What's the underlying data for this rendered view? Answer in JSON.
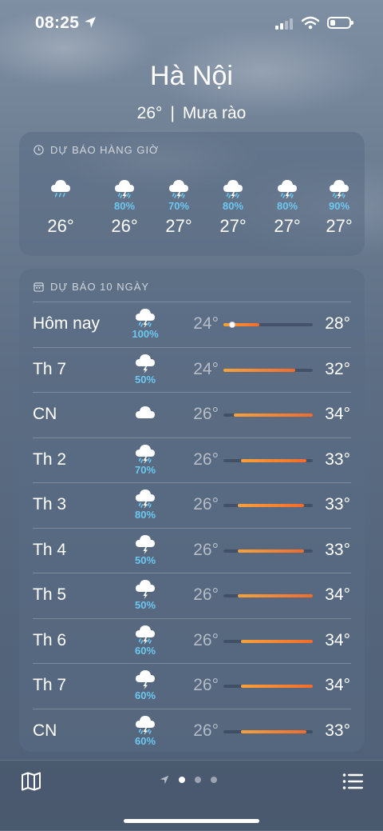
{
  "status_bar": {
    "time": "08:25",
    "icons": [
      "location-arrow-icon",
      "signal-icon",
      "wifi-icon",
      "battery-icon"
    ]
  },
  "location": {
    "city": "Hà Nội",
    "current_temp": "26°",
    "separator": "|",
    "condition": "Mưa rào"
  },
  "hourly": {
    "header": "DỰ BÁO HÀNG GIỜ",
    "items": [
      {
        "icon": "rain-cloud-icon",
        "precip": "",
        "temp": "26°"
      },
      {
        "icon": "thunderstorm-rain-icon",
        "precip": "80%",
        "temp": "26°"
      },
      {
        "icon": "thunderstorm-rain-icon",
        "precip": "70%",
        "temp": "27°"
      },
      {
        "icon": "thunderstorm-rain-icon",
        "precip": "80%",
        "temp": "27°"
      },
      {
        "icon": "thunderstorm-rain-icon",
        "precip": "80%",
        "temp": "27°"
      },
      {
        "icon": "thunderstorm-rain-icon",
        "precip": "90%",
        "temp": "27°"
      }
    ]
  },
  "daily": {
    "header": "DỰ BÁO 10 NGÀY",
    "range_scale": {
      "min": 24,
      "max": 34
    },
    "items": [
      {
        "day": "Hôm nay",
        "icon": "thunderstorm-rain-icon",
        "precip": "100%",
        "low": "24°",
        "high": "28°",
        "low_val": 24,
        "high_val": 28,
        "current_val": 25
      },
      {
        "day": "Th 7",
        "icon": "thunderstorm-icon",
        "precip": "50%",
        "low": "24°",
        "high": "32°",
        "low_val": 24,
        "high_val": 32
      },
      {
        "day": "CN",
        "icon": "cloud-icon",
        "precip": "",
        "low": "26°",
        "high": "34°",
        "low_val": 25.2,
        "high_val": 34
      },
      {
        "day": "Th 2",
        "icon": "thunderstorm-rain-icon",
        "precip": "70%",
        "low": "26°",
        "high": "33°",
        "low_val": 26,
        "high_val": 33.3
      },
      {
        "day": "Th 3",
        "icon": "thunderstorm-rain-icon",
        "precip": "80%",
        "low": "26°",
        "high": "33°",
        "low_val": 25.6,
        "high_val": 33
      },
      {
        "day": "Th 4",
        "icon": "thunderstorm-icon",
        "precip": "50%",
        "low": "26°",
        "high": "33°",
        "low_val": 25.6,
        "high_val": 33
      },
      {
        "day": "Th 5",
        "icon": "thunderstorm-icon",
        "precip": "50%",
        "low": "26°",
        "high": "34°",
        "low_val": 25.6,
        "high_val": 34
      },
      {
        "day": "Th 6",
        "icon": "thunderstorm-rain-icon",
        "precip": "60%",
        "low": "26°",
        "high": "34°",
        "low_val": 26,
        "high_val": 34
      },
      {
        "day": "Th 7",
        "icon": "thunderstorm-icon",
        "precip": "60%",
        "low": "26°",
        "high": "34°",
        "low_val": 26,
        "high_val": 34
      },
      {
        "day": "CN",
        "icon": "thunderstorm-rain-icon",
        "precip": "60%",
        "low": "26°",
        "high": "33°",
        "low_val": 26,
        "high_val": 33.3
      }
    ]
  },
  "bottom_bar": {
    "page_dots": 3,
    "active_page": 0
  },
  "colors": {
    "precip": "#6cc8f0",
    "bar_start": "#f7a13a",
    "bar_end": "#f26b2c"
  }
}
